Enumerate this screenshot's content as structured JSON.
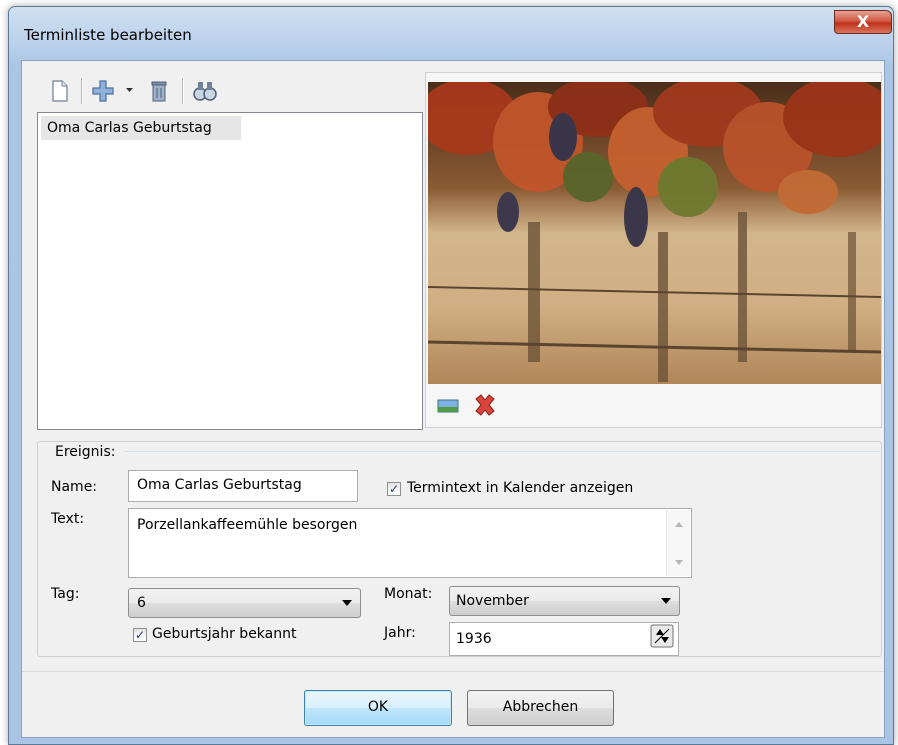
{
  "window": {
    "title": "Terminliste bearbeiten",
    "close_label": "X"
  },
  "toolbar": {
    "icons": [
      "new-document-icon",
      "add-icon",
      "dropdown-arrow-icon",
      "delete-icon",
      "search-binoculars-icon"
    ]
  },
  "event_list": {
    "items": [
      "Oma Carlas Geburtstag"
    ]
  },
  "image_panel": {
    "icons": [
      "insert-image-icon",
      "remove-image-icon"
    ]
  },
  "event_form": {
    "group_label": "Ereignis:",
    "name_label": "Name:",
    "name_value": "Oma Carlas Geburtstag",
    "show_text_checkbox_label": "Termintext in Kalender anzeigen",
    "show_text_checked": true,
    "text_label": "Text:",
    "text_value": "Porzellankaffeemühle besorgen",
    "day_label": "Tag:",
    "day_value": "6",
    "month_label": "Monat:",
    "month_value": "November",
    "birth_year_known_label": "Geburtsjahr bekannt",
    "birth_year_known_checked": true,
    "year_label": "Jahr:",
    "year_value": "1936"
  },
  "buttons": {
    "ok": "OK",
    "cancel": "Abbrechen"
  }
}
